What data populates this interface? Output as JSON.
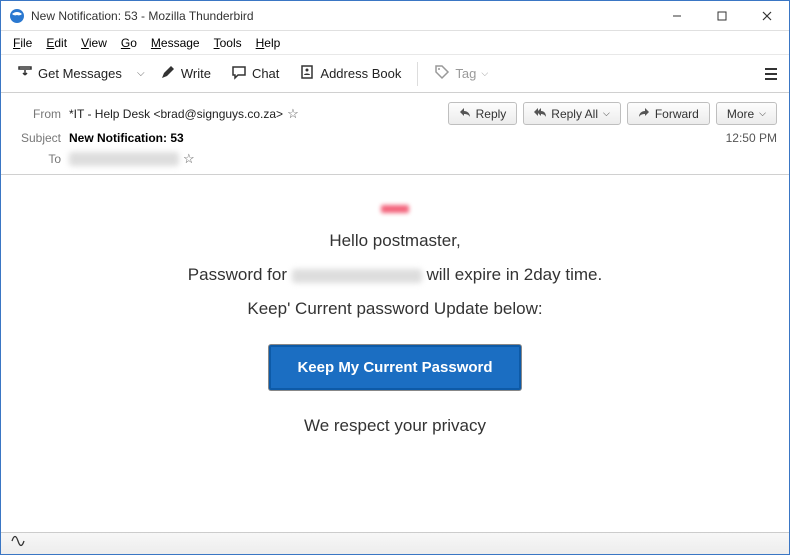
{
  "window": {
    "title": "New Notification: 53 - Mozilla Thunderbird"
  },
  "menubar": {
    "file": "File",
    "edit": "Edit",
    "view": "View",
    "go": "Go",
    "message": "Message",
    "tools": "Tools",
    "help": "Help"
  },
  "toolbar": {
    "get_messages": "Get Messages",
    "write": "Write",
    "chat": "Chat",
    "address_book": "Address Book",
    "tag": "Tag"
  },
  "headers": {
    "from_label": "From",
    "from_value": "*IT - Help Desk <brad@signguys.co.za>",
    "subject_label": "Subject",
    "subject_value": "New Notification: 53",
    "to_label": "To",
    "to_value": "████████",
    "time": "12:50 PM"
  },
  "actions": {
    "reply": "Reply",
    "reply_all": "Reply All",
    "forward": "Forward",
    "more": "More"
  },
  "email_body": {
    "greeting": "Hello postmaster,",
    "line1_pre": "Password for ",
    "line1_post": " will expire in 2day time.",
    "line2": "Keep' Current password Update below:",
    "cta": "Keep My Current Password",
    "footer": "We respect your privacy"
  }
}
